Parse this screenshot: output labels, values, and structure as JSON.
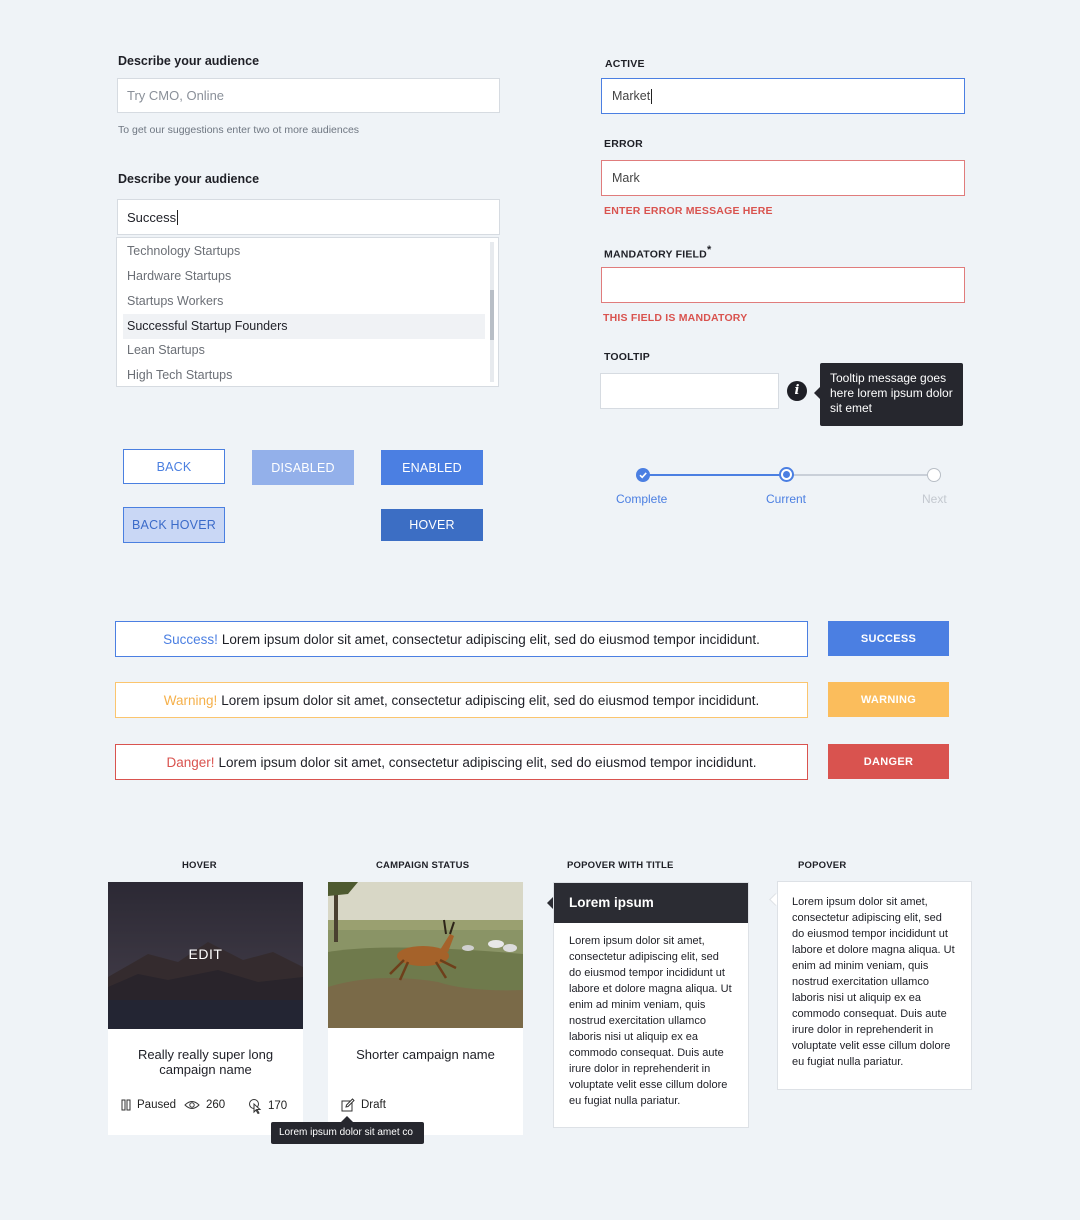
{
  "audience1": {
    "label": "Describe your audience",
    "placeholder": "Try CMO, Online",
    "helper": "To get our suggestions enter two ot more audiences"
  },
  "audience2": {
    "label": "Describe your audience",
    "value": "Success",
    "options": [
      "Technology Startups",
      "Hardware Startups",
      "Startups Workers",
      "Successful Startup Founders",
      "Lean Startups",
      "High Tech Startups"
    ],
    "selected_index": 3
  },
  "buttons": {
    "back": "BACK",
    "disabled": "DISABLED",
    "enabled": "ENABLED",
    "back_hover": "BACK HOVER",
    "hover": "HOVER"
  },
  "fields": {
    "active_label": "ACTIVE",
    "active_value": "Market",
    "error_label": "ERROR",
    "error_value": "Mark",
    "error_message": "ENTER ERROR MESSAGE HERE",
    "mandatory_label": "MANDATORY FIELD",
    "mandatory_star": "*",
    "mandatory_message": "THIS FIELD IS MANDATORY",
    "tooltip_label": "TOOLTIP",
    "tooltip_text": "Tooltip message goes here lorem ipsum dolor sit emet"
  },
  "stepper": {
    "steps": [
      "Complete",
      "Current",
      "Next"
    ]
  },
  "alerts": [
    {
      "prefix": "Success!",
      "text": "Lorem ipsum dolor sit amet, consectetur adipiscing elit, sed do eiusmod tempor incididunt.",
      "button": "SUCCESS",
      "color": "#4b7fe2"
    },
    {
      "prefix": "Warning!",
      "text": "Lorem ipsum dolor sit amet, consectetur adipiscing elit, sed do eiusmod tempor incididunt.",
      "button": "WARNING",
      "color": "#fbbd5c"
    },
    {
      "prefix": "Danger!",
      "text": "Lorem ipsum dolor sit amet, consectetur adipiscing elit, sed do eiusmod tempor incididunt.",
      "button": "DANGER",
      "color": "#d9534f"
    }
  ],
  "cards": {
    "hover_heading": "HOVER",
    "hover_edit": "EDIT",
    "hover_title": "Really really super long campaign name",
    "hover_status": "Paused",
    "hover_views": "260",
    "hover_clicks": "170",
    "status_heading": "CAMPAIGN STATUS",
    "status_title": "Shorter campaign name",
    "status_value": "Draft",
    "status_tooltip": "Lorem ipsum dolor sit amet co"
  },
  "popovers": {
    "titled_heading": "POPOVER WITH TITLE",
    "titled_title": "Lorem ipsum",
    "titled_body": "Lorem ipsum dolor sit amet, consectetur adipiscing elit, sed do eiusmod tempor incididunt ut labore et dolore magna aliqua. Ut enim ad minim veniam, quis nostrud exercitation ullamco laboris nisi ut aliquip ex ea commodo consequat. Duis aute irure dolor in reprehenderit in voluptate velit esse cillum dolore eu fugiat nulla pariatur.",
    "plain_heading": "POPOVER",
    "plain_body": "Lorem ipsum dolor sit amet, consectetur adipiscing elit, sed do eiusmod tempor incididunt ut labore et dolore magna aliqua. Ut enim ad minim veniam, quis nostrud exercitation ullamco laboris nisi ut aliquip ex ea commodo consequat. Duis aute irure dolor in reprehenderit in voluptate velit esse cillum dolore eu fugiat nulla pariatur."
  },
  "colors": {
    "accent": "#4b7fe2",
    "error": "#d9534f",
    "warning": "#fbbd5c",
    "dark": "#26272e"
  }
}
